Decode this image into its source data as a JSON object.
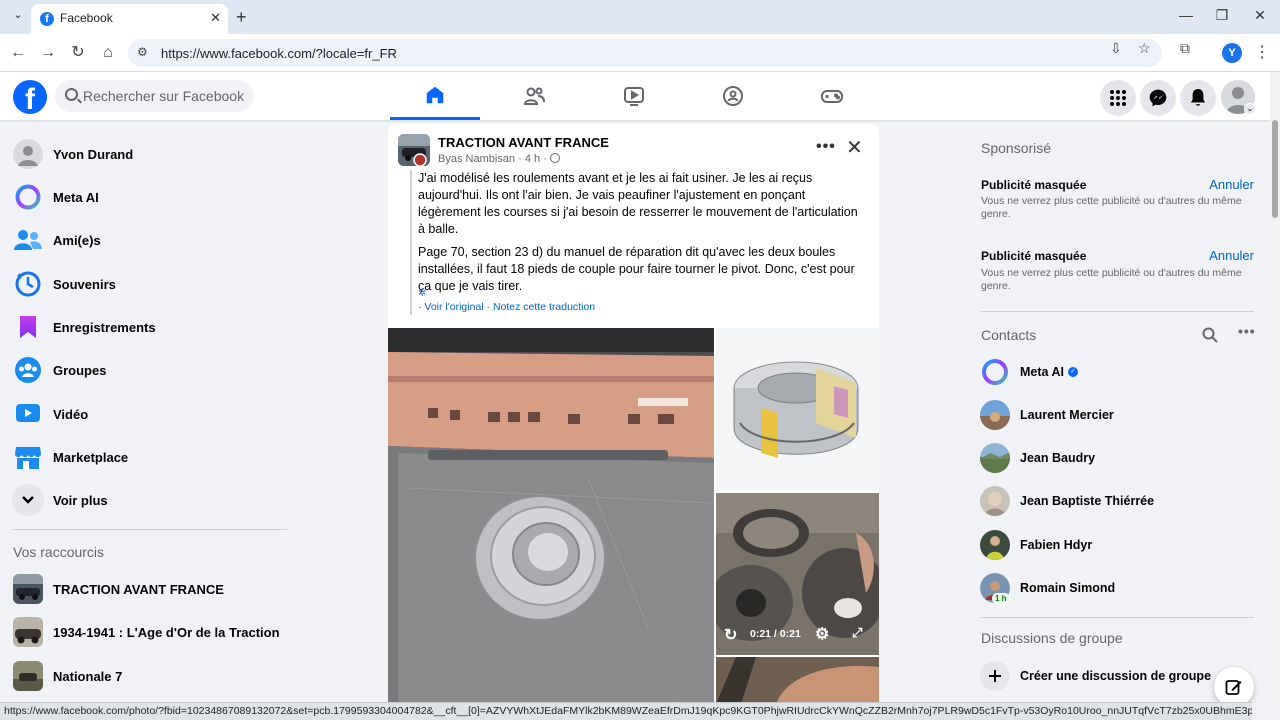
{
  "browser": {
    "tab_title": "Facebook",
    "tab_favicon": "f",
    "url": "https://www.facebook.com/?locale=fr_FR",
    "profile_initial": "Y",
    "status_url": "https://www.facebook.com/photo/?fbid=10234867089132072&set=pcb.1799593304004782&__cft__[0]=AZVYWhXtJEdaFMYlk2bKM89WZeaEfrDmJ19qKpc9KGT0PhjwRIUdrcCkYWnQcZZB2rMnh7oj7PLR9wD5c1FvTp-v53OyRo10Uroo_nnJUTqfVcT7zb25x0UBhmE3pQSDAtyVD-B7lV1N..."
  },
  "fb_header": {
    "logo": "f",
    "search_placeholder": "Rechercher sur Facebook",
    "nav_tabs": [
      "home-icon",
      "friends-icon",
      "watch-icon",
      "groups-icon",
      "gaming-icon"
    ],
    "right_icons": [
      "menu-grid-icon",
      "messenger-icon",
      "bell-icon",
      "account-avatar"
    ]
  },
  "left_sidebar": {
    "items": [
      {
        "label": "Yvon Durand",
        "icon": "profile-avatar"
      },
      {
        "label": "Meta AI",
        "icon": "meta-ai-icon"
      },
      {
        "label": "Ami(e)s",
        "icon": "friends-icon"
      },
      {
        "label": "Souvenirs",
        "icon": "memories-icon"
      },
      {
        "label": "Enregistrements",
        "icon": "bookmark-icon"
      },
      {
        "label": "Groupes",
        "icon": "groups-icon"
      },
      {
        "label": "Vidéo",
        "icon": "video-icon"
      },
      {
        "label": "Marketplace",
        "icon": "marketplace-icon"
      },
      {
        "label": "Voir plus",
        "icon": "chevron-down-icon"
      }
    ],
    "shortcuts_title": "Vos raccourcis",
    "shortcuts": [
      {
        "label": "TRACTION AVANT FRANCE"
      },
      {
        "label": "1934-1941 : L'Age d'Or de la Traction"
      },
      {
        "label": "Nationale 7"
      }
    ]
  },
  "post": {
    "group": "TRACTION AVANT FRANCE",
    "author": "Byas Nambisan",
    "time": "4 h",
    "paragraph1": "J'ai modélisé les roulements avant et je les ai fait usiner. Je les ai reçus aujourd'hui. Ils ont l'air bien. Je vais peaufiner l'ajustement en ponçant légèrement les courses si j'ai besoin de resserrer le mouvement de l'articulation à balle.",
    "paragraph2": "Page 70, section 23 d) du manuel de réparation dit qu'avec les deux boules installées, il faut 18 pieds de couple pour faire tourner le pivot. Donc, c'est pour ça que je vais tirer.",
    "see_original": "· Voir l'original",
    "rate_translation": "· Notez cette traduction",
    "video_time": "0:21 / 0:21"
  },
  "right_sidebar": {
    "sponsored_title": "Sponsorisé",
    "ads": [
      {
        "title": "Publicité masquée",
        "text": "Vous ne verrez plus cette publicité ou d'autres du même genre.",
        "undo": "Annuler"
      },
      {
        "title": "Publicité masquée",
        "text": "Vous ne verrez plus cette publicité ou d'autres du même genre.",
        "undo": "Annuler"
      }
    ],
    "contacts_title": "Contacts",
    "contacts": [
      {
        "name": "Meta AI",
        "verified": true
      },
      {
        "name": "Laurent Mercier"
      },
      {
        "name": "Jean Baudry"
      },
      {
        "name": "Jean Baptiste Thiérrée"
      },
      {
        "name": "Fabien Hdyr"
      },
      {
        "name": "Romain Simond",
        "badge": "1 h"
      }
    ],
    "group_chats_title": "Discussions de groupe",
    "create_group_chat": "Créer une discussion de groupe"
  },
  "colors": {
    "fb_blue": "#0866ff",
    "link_blue": "#0064d1",
    "page_bg": "#f0f2f5"
  }
}
